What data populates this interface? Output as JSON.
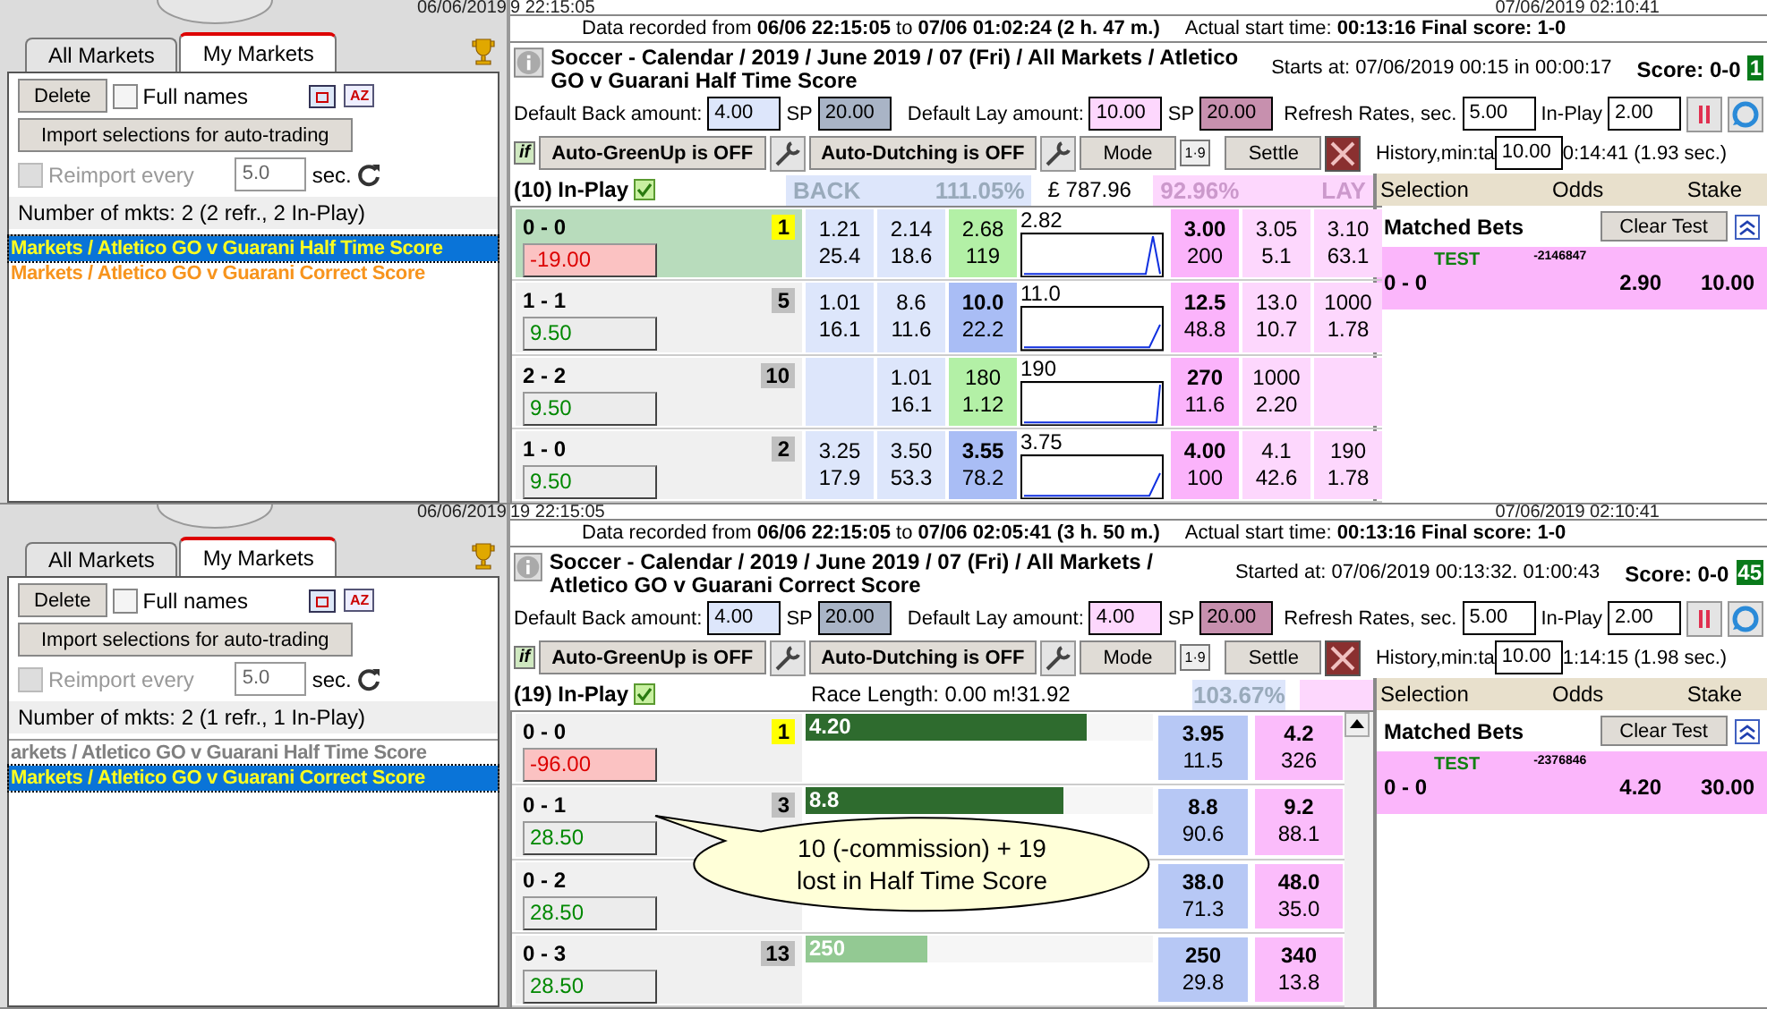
{
  "panes": [
    {
      "kind": "ladder",
      "stamps": {
        "left": "06/06/2019",
        "middle": "9 22:15:05",
        "right": "07/06/2019 02:10:41"
      },
      "tabs": [
        {
          "label": "All Markets",
          "selected": false
        },
        {
          "label": "My Markets",
          "selected": true
        }
      ],
      "delete": "Delete",
      "full_names": {
        "label": "Full names",
        "checked": false
      },
      "sort_icon": "AZ",
      "import": "Import selections for auto-trading",
      "reimport": {
        "label": "Reimport every",
        "checked": false,
        "disabled": true,
        "value": "5.0",
        "unit": "sec."
      },
      "count": "Number of mkts: 2 (2 refr., 2 In-Play)",
      "markets": [
        {
          "label": "Markets / Atletico GO v Guarani Half Time Score",
          "selected": true
        },
        {
          "label": "Markets / Atletico GO v Guarani Correct Score",
          "selected": false,
          "color": "#f7941d"
        }
      ],
      "recorded": "Data recorded from **06/06 22:15:05** to **07/06 01:02:24 (2 h. 47 m.)**",
      "actual": "Actual start time:  **00:13:16**  **Final score: 1-0**",
      "title": "Soccer - Calendar / 2019 / June 2019 / 07 (Fri) / All Markets / Atletico GO v Guarani Half Time Score",
      "starts": "Starts at: 07/06/2019 00:15 in 00:00:17",
      "score": "Score: 0-0",
      "score_badge": "1",
      "amounts": {
        "back_label": "Default Back amount:",
        "back": "4.00",
        "sp": "SP",
        "back_sp": "20.00",
        "lay_label": "Default Lay amount:",
        "lay": "10.00",
        "lay_sp_label": "SP",
        "lay_sp": "20.00",
        "refresh_label": "Refresh Rates, sec.",
        "refresh": "5.00",
        "inplay_label": "In-Play",
        "inplay": "2.00"
      },
      "toolbar": {
        "rule_icon": "if",
        "greenup": "Auto-GreenUp is OFF",
        "dutching": "Auto-Dutching is OFF",
        "mode": "Mode",
        "odds_icon": "1·9",
        "settle": "Settle",
        "history_label": "History,min:ta",
        "history": "10.00",
        "history_tail": "0:14:41 (1.93 sec.)"
      },
      "inplay": {
        "label": "(10) In-Play",
        "back_head": "BACK",
        "back_pct": "111.05%",
        "bank": "£ 787.96",
        "lay_pct": "92.96%",
        "lay_head": "LAY"
      },
      "columns": [
        "Selection",
        "Odds",
        "Stake"
      ],
      "matched": {
        "title": "Matched Bets",
        "clear": "Clear Test",
        "tag": "TEST",
        "id": "-2146847",
        "selection": "0 - 0",
        "odds": "2.90",
        "stake": "10.00"
      },
      "rows": [
        {
          "name": "0 - 0",
          "badge": {
            "label": "1",
            "color": "#ffff00"
          },
          "pl": "-19.00",
          "highlighted": true,
          "last": "2.82",
          "back": [
            {
              "kind": "price",
              "odds": "1.21",
              "size": "25.4"
            },
            {
              "kind": "price",
              "odds": "2.14",
              "size": "18.6"
            },
            {
              "kind": "price",
              "odds": "2.68",
              "size": "119",
              "color": "#b3f0a6",
              "bold": false
            }
          ],
          "lay": [
            {
              "kind": "price",
              "odds": "3.00",
              "size": "200",
              "color": "#fbb3fb",
              "bold": true
            },
            {
              "kind": "price",
              "odds": "3.05",
              "size": "5.1"
            },
            {
              "kind": "price",
              "odds": "3.10",
              "size": "63.1"
            }
          ]
        },
        {
          "name": "1 - 1",
          "badge": {
            "label": "5",
            "color": "#c0c0c0"
          },
          "pl": "9.50",
          "highlighted": false,
          "last": "11.0",
          "back": [
            {
              "kind": "price",
              "odds": "1.01",
              "size": "16.1"
            },
            {
              "kind": "price",
              "odds": "8.6",
              "size": "11.6"
            },
            {
              "kind": "price",
              "odds": "10.0",
              "size": "22.2",
              "color": "#a9bdf5",
              "bold": true
            }
          ],
          "lay": [
            {
              "kind": "price",
              "odds": "12.5",
              "size": "48.8",
              "color": "#fbb3fb",
              "bold": true
            },
            {
              "kind": "price",
              "odds": "13.0",
              "size": "10.7"
            },
            {
              "kind": "price",
              "odds": "1000",
              "size": "1.78"
            }
          ]
        },
        {
          "name": "2 - 2",
          "badge": {
            "label": "10",
            "color": "#c0c0c0"
          },
          "pl": "9.50",
          "highlighted": false,
          "last": "190",
          "back": [
            {
              "kind": "empty"
            },
            {
              "kind": "price",
              "odds": "1.01",
              "size": "16.1"
            },
            {
              "kind": "price",
              "odds": "180",
              "size": "1.12",
              "color": "#b3f0a6",
              "bold": false
            }
          ],
          "lay": [
            {
              "kind": "price",
              "odds": "270",
              "size": "11.6",
              "color": "#fbb3fb",
              "bold": true
            },
            {
              "kind": "price",
              "odds": "1000",
              "size": "2.20"
            },
            {
              "kind": "empty"
            }
          ]
        },
        {
          "name": "1 - 0",
          "badge": {
            "label": "2",
            "color": "#c0c0c0"
          },
          "pl": "9.50",
          "highlighted": false,
          "last": "3.75",
          "back": [
            {
              "kind": "price",
              "odds": "3.25",
              "size": "17.9"
            },
            {
              "kind": "price",
              "odds": "3.50",
              "size": "53.3"
            },
            {
              "kind": "price",
              "odds": "3.55",
              "size": "78.2",
              "color": "#a9bdf5",
              "bold": true
            }
          ],
          "lay": [
            {
              "kind": "price",
              "odds": "4.00",
              "size": "100",
              "color": "#fbb3fb",
              "bold": true
            },
            {
              "kind": "price",
              "odds": "4.1",
              "size": "42.6"
            },
            {
              "kind": "price",
              "odds": "190",
              "size": "1.78"
            }
          ]
        }
      ]
    },
    {
      "kind": "bars",
      "stamps": {
        "left": "06/06/2019",
        "middle": "19 22:15:05",
        "right": "07/06/2019 02:10:41"
      },
      "tabs": [
        {
          "label": "All Markets",
          "selected": false
        },
        {
          "label": "My Markets",
          "selected": true
        }
      ],
      "delete": "Delete",
      "full_names": {
        "label": "Full names",
        "checked": false
      },
      "sort_icon": "AZ",
      "import": "Import selections for auto-trading",
      "reimport": {
        "label": "Reimport every",
        "checked": false,
        "disabled": true,
        "value": "5.0",
        "unit": "sec."
      },
      "count": "Number of mkts: 2 (1 refr., 1 In-Play)",
      "markets": [
        {
          "label": "arkets / Atletico GO v Guarani Half Time Score",
          "selected": false,
          "color": "#808080"
        },
        {
          "label": "Markets / Atletico GO v Guarani Correct Score",
          "selected": true
        }
      ],
      "recorded": "Data recorded from **06/06 22:15:05** to **07/06 02:05:41 (3 h. 50 m.)**",
      "actual": "Actual start time:  **00:13:16**  **Final score: 1-0**",
      "title": "Soccer - Calendar / 2019 / June 2019 / 07 (Fri) / All Markets / Atletico GO v Guarani Correct Score",
      "starts": "Started at: 07/06/2019 00:13:32. 01:00:43",
      "score": "Score: 0-0",
      "score_badge": "45",
      "amounts": {
        "back_label": "Default Back amount:",
        "back": "4.00",
        "sp": "SP",
        "back_sp": "20.00",
        "lay_label": "Default Lay amount:",
        "lay": "4.00",
        "lay_sp_label": "SP",
        "lay_sp": "20.00",
        "refresh_label": "Refresh Rates, sec.",
        "refresh": "5.00",
        "inplay_label": "In-Play",
        "inplay": "2.00"
      },
      "toolbar": {
        "rule_icon": "if",
        "greenup": "Auto-GreenUp is OFF",
        "dutching": "Auto-Dutching is OFF",
        "mode": "Mode",
        "odds_icon": "1·9",
        "settle": "Settle",
        "history_label": "History,min:ta",
        "history": "10.00",
        "history_tail": "1:14:15 (1.98 sec.)"
      },
      "inplay": {
        "label": "(19) In-Play",
        "race": "Race Length: 0.00 m!31.92",
        "back_pct": "103.67%"
      },
      "columns": [
        "Selection",
        "Odds",
        "Stake"
      ],
      "matched": {
        "title": "Matched Bets",
        "clear": "Clear Test",
        "tag": "TEST",
        "id": "-2376846",
        "selection": "0 - 0",
        "odds": "4.20",
        "stake": "30.00"
      },
      "callout": "10 (-commission) + 19\nlost in Half Time Score",
      "rows": [
        {
          "name": "0 - 0",
          "badge": {
            "label": "1",
            "color": "#ffff00"
          },
          "pl": "-96.00",
          "highlighted": false,
          "bar": {
            "label": "4.20",
            "level": 0.81,
            "color": "#2e6b2e"
          },
          "back": {
            "odds": "3.95",
            "size": "11.5"
          },
          "lay": {
            "odds": "4.2",
            "size": "326"
          }
        },
        {
          "name": "0 - 1",
          "badge": {
            "label": "3",
            "color": "#c0c0c0"
          },
          "pl": "28.50",
          "highlighted": false,
          "bar": {
            "label": "8.8",
            "level": 0.74,
            "color": "#2e6b2e"
          },
          "back": {
            "odds": "8.8",
            "size": "90.6"
          },
          "lay": {
            "odds": "9.2",
            "size": "88.1"
          }
        },
        {
          "name": "0 - 2",
          "pl": "28.50",
          "highlighted": false,
          "back": {
            "odds": "38.0",
            "size": "71.3"
          },
          "lay": {
            "odds": "48.0",
            "size": "35.0"
          }
        },
        {
          "name": "0 - 3",
          "badge": {
            "label": "13",
            "color": "#c0c0c0"
          },
          "pl": "28.50",
          "highlighted": false,
          "bar": {
            "label": "250",
            "level": 0.35,
            "color": "#93c993"
          },
          "back": {
            "odds": "250",
            "size": "29.8"
          },
          "lay": {
            "odds": "340",
            "size": "13.8"
          }
        }
      ]
    }
  ]
}
